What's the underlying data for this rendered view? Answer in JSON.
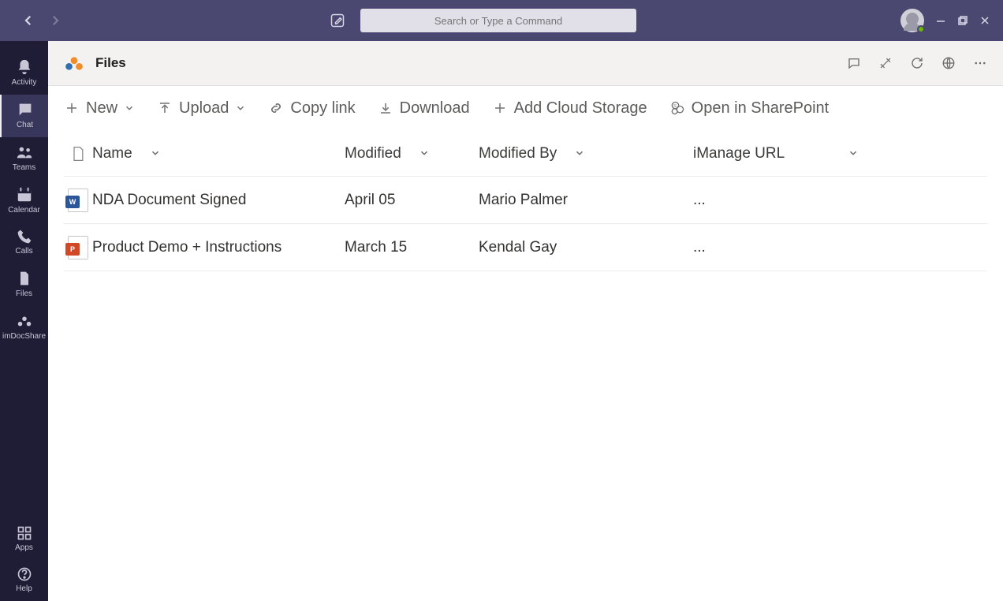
{
  "search": {
    "placeholder": "Search or Type a Command"
  },
  "rail": {
    "items": [
      {
        "label": "Activity"
      },
      {
        "label": "Chat"
      },
      {
        "label": "Teams"
      },
      {
        "label": "Calendar"
      },
      {
        "label": "Calls"
      },
      {
        "label": "Files"
      },
      {
        "label": "imDocShare"
      }
    ],
    "bottom": [
      {
        "label": "Apps"
      },
      {
        "label": "Help"
      }
    ]
  },
  "header": {
    "title": "Files"
  },
  "commands": {
    "new": "New",
    "upload": "Upload",
    "copylink": "Copy link",
    "download": "Download",
    "addcloud": "Add Cloud Storage",
    "sharepoint": "Open in SharePoint"
  },
  "columns": {
    "name": "Name",
    "modified": "Modified",
    "modified_by": "Modified By",
    "imanage_url": "iManage URL"
  },
  "rows": [
    {
      "name": "NDA Document Signed",
      "modified": "April 05",
      "by": "Mario Palmer",
      "url": "...",
      "type": "word"
    },
    {
      "name": "Product Demo + Instructions",
      "modified": "March 15",
      "by": "Kendal Gay",
      "url": "...",
      "type": "ppt"
    }
  ]
}
